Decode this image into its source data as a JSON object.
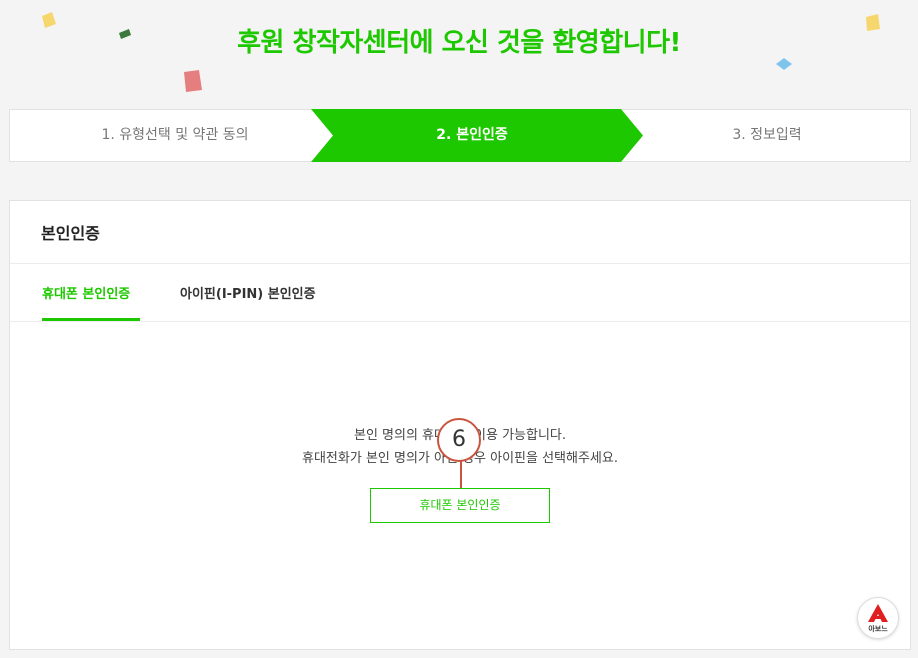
{
  "header": {
    "title": "후원 창작자센터에 오신 것을 환영합니다!"
  },
  "colors": {
    "accent": "#1ec800",
    "callout": "#c8553d"
  },
  "steps": [
    {
      "label": "1. 유형선택 및 약관 동의",
      "state": "done"
    },
    {
      "label": "2. 본인인증",
      "state": "active"
    },
    {
      "label": "3. 정보입력",
      "state": "pending"
    }
  ],
  "panel": {
    "title": "본인인증",
    "tabs": [
      {
        "label": "휴대폰 본인인증",
        "active": true
      },
      {
        "label": "아이핀(I-PIN) 본인인증",
        "active": false
      }
    ],
    "desc_line1": "본인 명의의 휴대폰만 이용 가능합니다.",
    "desc_line2": "휴대전화가 본인 명의가 아닌 경우 아이핀을 선택해주세요.",
    "button_label": "휴대폰 본인인증"
  },
  "callout": {
    "number": "6"
  },
  "float_button": {
    "icon": "a-logo-icon",
    "label": "아보느"
  }
}
